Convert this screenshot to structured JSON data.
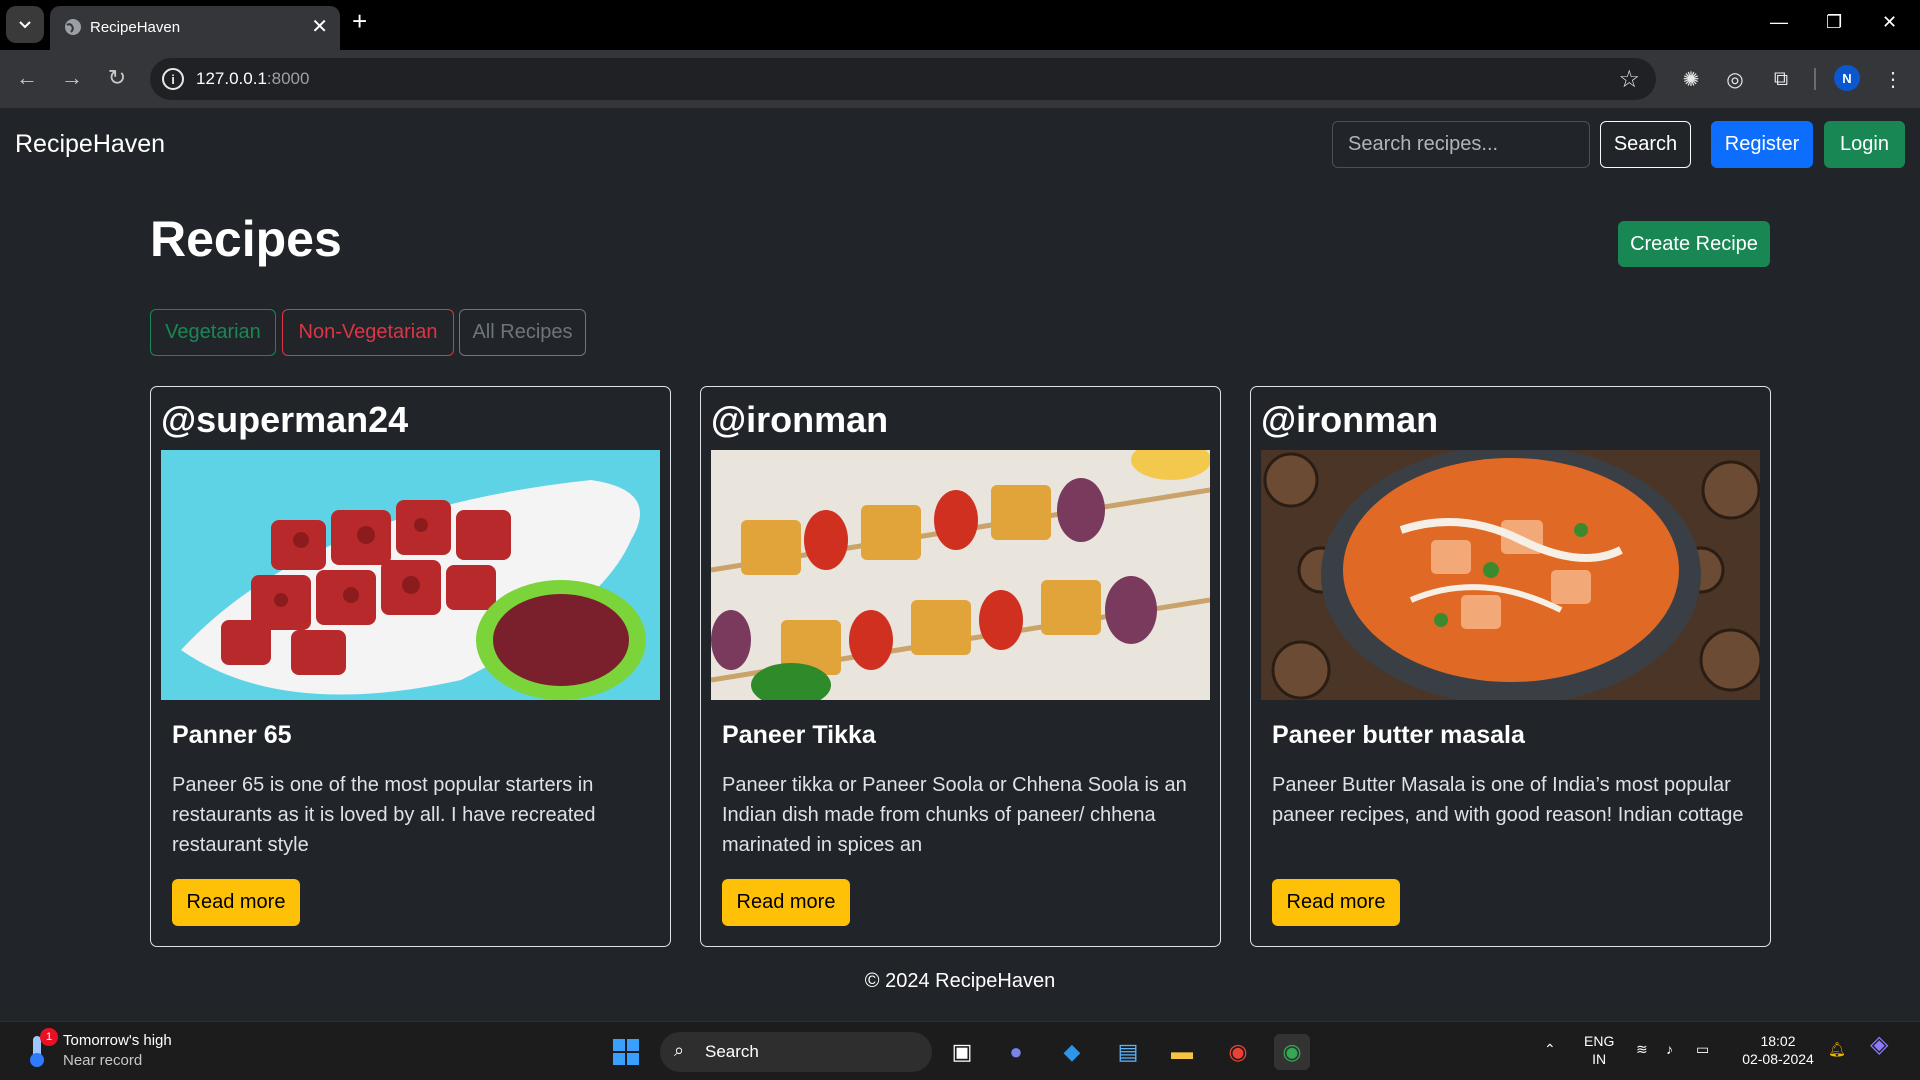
{
  "browser": {
    "tab_title": "RecipeHaven",
    "url_host": "127.0.0.1",
    "url_port": ":8000"
  },
  "nav": {
    "brand": "RecipeHaven",
    "search_placeholder": "Search recipes...",
    "search_label": "Search",
    "register_label": "Register",
    "login_label": "Login"
  },
  "main": {
    "title": "Recipes",
    "create_label": "Create Recipe",
    "filters": {
      "veg": "Vegetarian",
      "nonveg": "Non-Vegetarian",
      "all": "All Recipes"
    },
    "cards": [
      {
        "user": "@superman24",
        "title": "Panner 65",
        "text": "Paneer 65 is one of the most popular starters in restaurants as it is loved by all. I have recreated restaurant style",
        "read_more": "Read more"
      },
      {
        "user": "@ironman",
        "title": "Paneer Tikka",
        "text": "Paneer tikka or Paneer Soola or Chhena Soola is an Indian dish made from chunks of paneer/ chhena marinated in spices an",
        "read_more": "Read more"
      },
      {
        "user": "@ironman",
        "title": "Paneer butter masala",
        "text": "Paneer Butter Masala is one of India’s most popular paneer recipes, and with good reason! Indian cottage",
        "read_more": "Read more"
      }
    ]
  },
  "footer": {
    "text": "© 2024 RecipeHaven"
  },
  "taskbar": {
    "weather_badge": "1",
    "weather_line1": "Tomorrow's high",
    "weather_line2": "Near record",
    "search_label": "Search",
    "lang_line1": "ENG",
    "lang_line2": "IN",
    "time": "18:02",
    "date": "02-08-2024"
  },
  "colors": {
    "primary": "#0d6efd",
    "success": "#198754",
    "danger": "#dc3545",
    "warning": "#ffc107",
    "secondary": "#6c757d",
    "page_bg": "#212529"
  }
}
